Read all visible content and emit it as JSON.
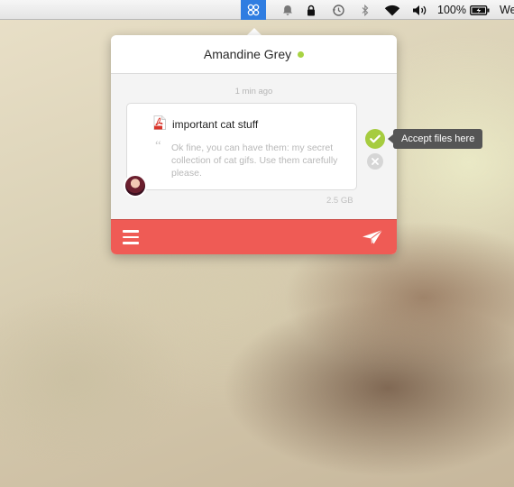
{
  "menubar": {
    "icons": [
      "app-icon",
      "notification-bell-icon",
      "lock-icon",
      "time-machine-icon",
      "bluetooth-icon",
      "wifi-icon",
      "volume-icon",
      "battery-icon"
    ],
    "battery_percent": "100%",
    "clock_partial": "We"
  },
  "popover": {
    "contact_name": "Amandine Grey",
    "status_color": "#a8d343",
    "timestamp": "1 min ago",
    "message": {
      "file_icon": "pdf-icon",
      "file_name": "important cat stuff",
      "quote": "“",
      "text": "Ok fine, you can have them: my secret collection of cat gifs. Use them carefully please.",
      "size": "2.5 GB"
    },
    "actions": {
      "accept_tooltip": "Accept files here",
      "accept_color": "#a6cc3f"
    },
    "footer": {
      "menu_icon": "hamburger-menu-icon",
      "send_icon": "paper-plane-icon",
      "color": "#ef5b55"
    }
  }
}
